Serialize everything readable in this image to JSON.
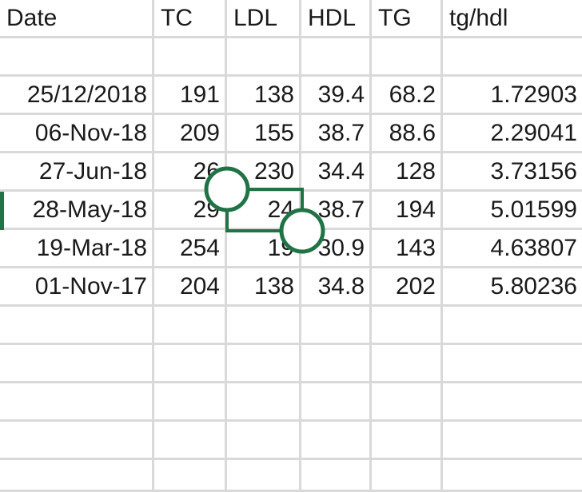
{
  "sheet": {
    "columns": [
      "Date",
      "TC",
      "LDL",
      "HDL",
      "TG",
      "tg/hdl"
    ],
    "rows": [
      [
        "",
        "",
        "",
        "",
        "",
        ""
      ],
      [
        "25/12/2018",
        "191",
        "138",
        "39.4",
        "68.2",
        "1.72903"
      ],
      [
        "06-Nov-18",
        "209",
        "155",
        "38.7",
        "88.6",
        "2.29041"
      ],
      [
        "27-Jun-18",
        "26",
        "230",
        "34.4",
        "128",
        "3.73156"
      ],
      [
        "28-May-18",
        "29",
        "24",
        "38.7",
        "194",
        "5.01599"
      ],
      [
        "19-Mar-18",
        "254",
        "19",
        "30.9",
        "143",
        "4.63807"
      ],
      [
        "01-Nov-17",
        "204",
        "138",
        "34.8",
        "202",
        "5.80236"
      ],
      [
        "",
        "",
        "",
        "",
        "",
        ""
      ],
      [
        "",
        "",
        "",
        "",
        "",
        ""
      ],
      [
        "",
        "",
        "",
        "",
        "",
        ""
      ],
      [
        "",
        "",
        "",
        "",
        "",
        ""
      ],
      [
        "",
        "",
        "",
        "",
        "",
        ""
      ]
    ]
  },
  "selection": {
    "color": "#217346",
    "handles": [
      "selection-start-handle",
      "selection-end-handle"
    ]
  }
}
